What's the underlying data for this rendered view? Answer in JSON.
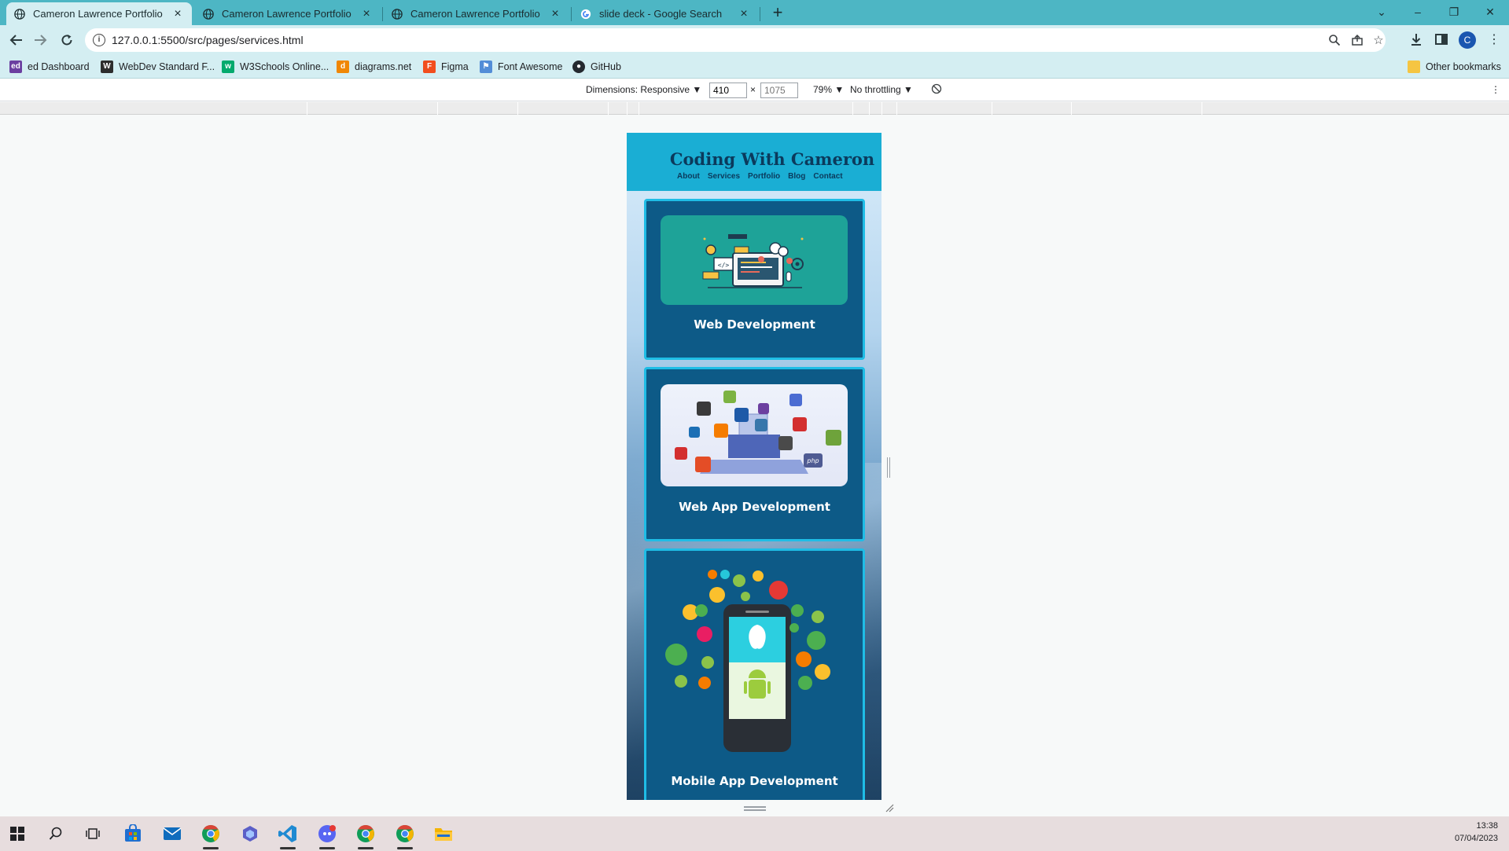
{
  "browser": {
    "tabs": [
      {
        "title": "Cameron Lawrence Portfolio",
        "active": true,
        "icon": "globe-icon"
      },
      {
        "title": "Cameron Lawrence Portfolio",
        "active": false,
        "icon": "globe-icon"
      },
      {
        "title": "Cameron Lawrence Portfolio",
        "active": false,
        "icon": "globe-icon"
      },
      {
        "title": "slide deck - Google Search",
        "active": false,
        "icon": "google-icon"
      }
    ],
    "tab_close_glyph": "×",
    "new_tab_glyph": "+",
    "window_controls": {
      "dropdown": "⌄",
      "minimize": "–",
      "restore": "❐",
      "close": "✕"
    },
    "url": "127.0.0.1:5500/src/pages/services.html",
    "profile_initial": "C",
    "bookmarks": [
      {
        "label": "ed Dashboard",
        "icon_text": "ed",
        "color": "#6b3fa0"
      },
      {
        "label": "WebDev Standard F...",
        "icon_text": "W",
        "color": "#2d2d2d"
      },
      {
        "label": "W3Schools Online...",
        "icon_text": "w",
        "color": "#04aa6d"
      },
      {
        "label": "diagrams.net",
        "icon_text": "d",
        "color": "#f08705"
      },
      {
        "label": "Figma",
        "icon_text": "F",
        "color": "#f24e1e"
      },
      {
        "label": "Font Awesome",
        "icon_text": "⚑",
        "color": "#538dd7"
      },
      {
        "label": "GitHub",
        "icon_text": "●",
        "color": "#24292f"
      }
    ],
    "other_bookmarks": "Other bookmarks"
  },
  "devtools": {
    "dimensions_label": "Dimensions: Responsive ▼",
    "width": "410",
    "times": "×",
    "height": "1075",
    "zoom": "79% ▼",
    "throttling": "No throttling ▼",
    "more": "⋮"
  },
  "site": {
    "title": "Coding With Cameron",
    "nav": [
      "About",
      "Services",
      "Portfolio",
      "Blog",
      "Contact"
    ],
    "services": [
      {
        "title": "Web Development"
      },
      {
        "title": "Web App Development"
      },
      {
        "title": "Mobile App Development"
      }
    ]
  },
  "taskbar": {
    "time": "13:38",
    "date": "07/04/2023",
    "colors": {
      "chrome_red": "#db4437",
      "chrome_yellow": "#f4b400",
      "chrome_green": "#0f9d58",
      "chrome_blue": "#4285f4",
      "vscode": "#1f8ad2"
    }
  }
}
